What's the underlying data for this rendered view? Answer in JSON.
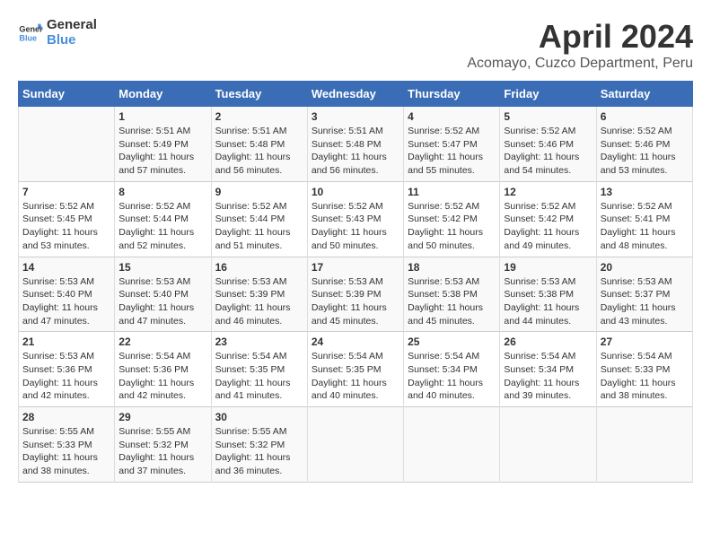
{
  "header": {
    "logo_general": "General",
    "logo_blue": "Blue",
    "month_year": "April 2024",
    "location": "Acomayo, Cuzco Department, Peru"
  },
  "calendar": {
    "days_of_week": [
      "Sunday",
      "Monday",
      "Tuesday",
      "Wednesday",
      "Thursday",
      "Friday",
      "Saturday"
    ],
    "weeks": [
      [
        {
          "day": "",
          "info": ""
        },
        {
          "day": "1",
          "info": "Sunrise: 5:51 AM\nSunset: 5:49 PM\nDaylight: 11 hours\nand 57 minutes."
        },
        {
          "day": "2",
          "info": "Sunrise: 5:51 AM\nSunset: 5:48 PM\nDaylight: 11 hours\nand 56 minutes."
        },
        {
          "day": "3",
          "info": "Sunrise: 5:51 AM\nSunset: 5:48 PM\nDaylight: 11 hours\nand 56 minutes."
        },
        {
          "day": "4",
          "info": "Sunrise: 5:52 AM\nSunset: 5:47 PM\nDaylight: 11 hours\nand 55 minutes."
        },
        {
          "day": "5",
          "info": "Sunrise: 5:52 AM\nSunset: 5:46 PM\nDaylight: 11 hours\nand 54 minutes."
        },
        {
          "day": "6",
          "info": "Sunrise: 5:52 AM\nSunset: 5:46 PM\nDaylight: 11 hours\nand 53 minutes."
        }
      ],
      [
        {
          "day": "7",
          "info": "Sunrise: 5:52 AM\nSunset: 5:45 PM\nDaylight: 11 hours\nand 53 minutes."
        },
        {
          "day": "8",
          "info": "Sunrise: 5:52 AM\nSunset: 5:44 PM\nDaylight: 11 hours\nand 52 minutes."
        },
        {
          "day": "9",
          "info": "Sunrise: 5:52 AM\nSunset: 5:44 PM\nDaylight: 11 hours\nand 51 minutes."
        },
        {
          "day": "10",
          "info": "Sunrise: 5:52 AM\nSunset: 5:43 PM\nDaylight: 11 hours\nand 50 minutes."
        },
        {
          "day": "11",
          "info": "Sunrise: 5:52 AM\nSunset: 5:42 PM\nDaylight: 11 hours\nand 50 minutes."
        },
        {
          "day": "12",
          "info": "Sunrise: 5:52 AM\nSunset: 5:42 PM\nDaylight: 11 hours\nand 49 minutes."
        },
        {
          "day": "13",
          "info": "Sunrise: 5:52 AM\nSunset: 5:41 PM\nDaylight: 11 hours\nand 48 minutes."
        }
      ],
      [
        {
          "day": "14",
          "info": "Sunrise: 5:53 AM\nSunset: 5:40 PM\nDaylight: 11 hours\nand 47 minutes."
        },
        {
          "day": "15",
          "info": "Sunrise: 5:53 AM\nSunset: 5:40 PM\nDaylight: 11 hours\nand 47 minutes."
        },
        {
          "day": "16",
          "info": "Sunrise: 5:53 AM\nSunset: 5:39 PM\nDaylight: 11 hours\nand 46 minutes."
        },
        {
          "day": "17",
          "info": "Sunrise: 5:53 AM\nSunset: 5:39 PM\nDaylight: 11 hours\nand 45 minutes."
        },
        {
          "day": "18",
          "info": "Sunrise: 5:53 AM\nSunset: 5:38 PM\nDaylight: 11 hours\nand 45 minutes."
        },
        {
          "day": "19",
          "info": "Sunrise: 5:53 AM\nSunset: 5:38 PM\nDaylight: 11 hours\nand 44 minutes."
        },
        {
          "day": "20",
          "info": "Sunrise: 5:53 AM\nSunset: 5:37 PM\nDaylight: 11 hours\nand 43 minutes."
        }
      ],
      [
        {
          "day": "21",
          "info": "Sunrise: 5:53 AM\nSunset: 5:36 PM\nDaylight: 11 hours\nand 42 minutes."
        },
        {
          "day": "22",
          "info": "Sunrise: 5:54 AM\nSunset: 5:36 PM\nDaylight: 11 hours\nand 42 minutes."
        },
        {
          "day": "23",
          "info": "Sunrise: 5:54 AM\nSunset: 5:35 PM\nDaylight: 11 hours\nand 41 minutes."
        },
        {
          "day": "24",
          "info": "Sunrise: 5:54 AM\nSunset: 5:35 PM\nDaylight: 11 hours\nand 40 minutes."
        },
        {
          "day": "25",
          "info": "Sunrise: 5:54 AM\nSunset: 5:34 PM\nDaylight: 11 hours\nand 40 minutes."
        },
        {
          "day": "26",
          "info": "Sunrise: 5:54 AM\nSunset: 5:34 PM\nDaylight: 11 hours\nand 39 minutes."
        },
        {
          "day": "27",
          "info": "Sunrise: 5:54 AM\nSunset: 5:33 PM\nDaylight: 11 hours\nand 38 minutes."
        }
      ],
      [
        {
          "day": "28",
          "info": "Sunrise: 5:55 AM\nSunset: 5:33 PM\nDaylight: 11 hours\nand 38 minutes."
        },
        {
          "day": "29",
          "info": "Sunrise: 5:55 AM\nSunset: 5:32 PM\nDaylight: 11 hours\nand 37 minutes."
        },
        {
          "day": "30",
          "info": "Sunrise: 5:55 AM\nSunset: 5:32 PM\nDaylight: 11 hours\nand 36 minutes."
        },
        {
          "day": "",
          "info": ""
        },
        {
          "day": "",
          "info": ""
        },
        {
          "day": "",
          "info": ""
        },
        {
          "day": "",
          "info": ""
        }
      ]
    ]
  }
}
